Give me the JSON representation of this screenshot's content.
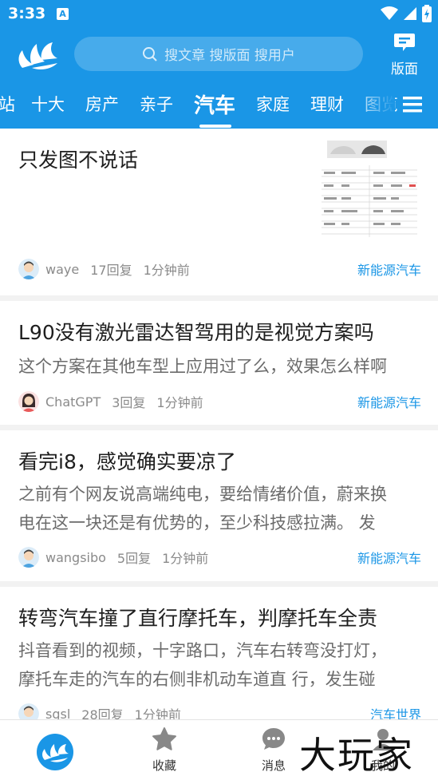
{
  "status_bar": {
    "time": "3:33",
    "app_icon_letter": "A"
  },
  "header": {
    "search_placeholder": "搜文章 搜版面 搜用户",
    "board_button_label": "版面"
  },
  "tabs": [
    "站",
    "十大",
    "房产",
    "亲子",
    "汽车",
    "家庭",
    "理财",
    "图览"
  ],
  "active_tab": "汽车",
  "posts": [
    {
      "title": "只发图不说话",
      "excerpt": [],
      "author": "waye",
      "replies": "17回复",
      "time": "1分钟前",
      "category": "新能源汽车",
      "has_thumbnail": true
    },
    {
      "title": "L90没有激光雷达智驾用的是视觉方案吗",
      "excerpt": [
        "这个方案在其他车型上应用过了么，效果怎么样啊"
      ],
      "author": "ChatGPT",
      "replies": "3回复",
      "time": "1分钟前",
      "category": "新能源汽车",
      "has_thumbnail": false
    },
    {
      "title": "看完i8，感觉确实要凉了",
      "excerpt": [
        "之前有个网友说高端纯电，要给情绪价值，蔚来换",
        "电在这一块还是有优势的，至少科技感拉满。 发"
      ],
      "author": "wangsibo",
      "replies": "5回复",
      "time": "1分钟前",
      "category": "新能源汽车",
      "has_thumbnail": false
    },
    {
      "title": "转弯汽车撞了直行摩托车，判摩托车全责",
      "excerpt": [
        "抖音看到的视频，十字路口，汽车右转弯没打灯，",
        "摩托车走的汽车的右侧非机动车道直 行，发生碰"
      ],
      "author": "sgsl",
      "replies": "28回复",
      "time": "1分钟前",
      "category": "汽车世界",
      "has_thumbnail": false
    }
  ],
  "bottom_nav": [
    {
      "label": "",
      "icon": "home-logo-icon"
    },
    {
      "label": "收藏",
      "icon": "star-icon"
    },
    {
      "label": "消息",
      "icon": "chat-bubble-icon"
    },
    {
      "label": "我的",
      "icon": "user-icon"
    }
  ],
  "watermark": "大玩家",
  "colors": {
    "primary": "#1a96e6",
    "text": "#1e1e1e",
    "muted": "#8a8a8a",
    "link": "#1a96e6"
  }
}
